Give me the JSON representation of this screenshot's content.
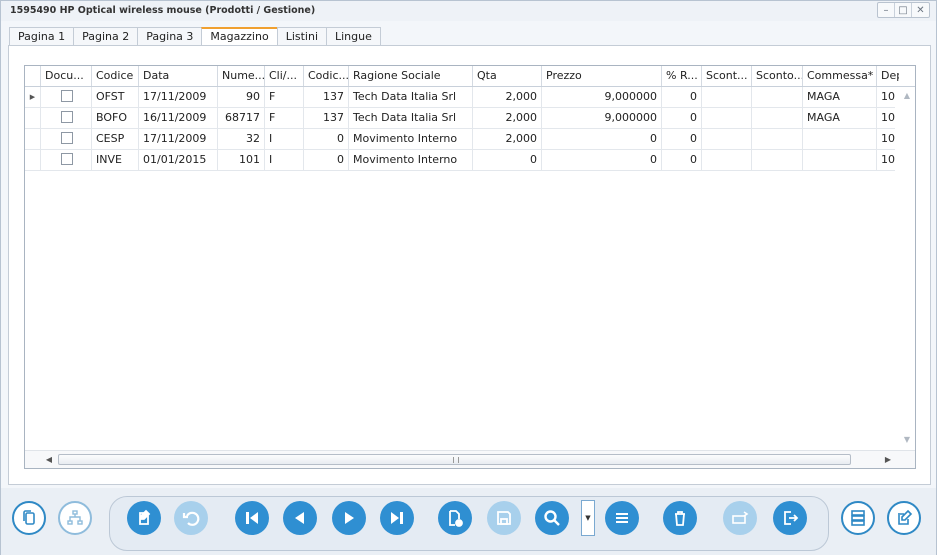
{
  "window": {
    "title": "1595490 HP Optical wireless mouse (Prodotti / Gestione)",
    "controls": [
      "minimize",
      "maximize",
      "close"
    ]
  },
  "tabs": [
    {
      "label": "Pagina 1",
      "active": false
    },
    {
      "label": "Pagina 2",
      "active": false
    },
    {
      "label": "Pagina 3",
      "active": false
    },
    {
      "label": "Magazzino",
      "active": true
    },
    {
      "label": "Listini",
      "active": false
    },
    {
      "label": "Lingue",
      "active": false
    }
  ],
  "grid": {
    "columns": [
      "Docu...",
      "Codice",
      "Data",
      "Nume...",
      "Cli/...",
      "Codic...",
      "Ragione Sociale",
      "Qta",
      "Prezzo",
      "% R...",
      "Scont...",
      "Sconto...",
      "Commessa*",
      "Dep"
    ],
    "rows": [
      {
        "documento": false,
        "codice": "OFST",
        "data": "17/11/2009",
        "numero": "90",
        "clifor": "F",
        "codice_cli": "137",
        "ragione_sociale": "Tech Data Italia Srl",
        "qta": "2,000",
        "prezzo": "9,000000",
        "perc_r": "0",
        "sconto1": "",
        "sconto2": "",
        "commessa": "MAGA",
        "dep": "10",
        "current": true
      },
      {
        "documento": false,
        "codice": "BOFO",
        "data": "16/11/2009",
        "numero": "68717",
        "clifor": "F",
        "codice_cli": "137",
        "ragione_sociale": "Tech Data Italia Srl",
        "qta": "2,000",
        "prezzo": "9,000000",
        "perc_r": "0",
        "sconto1": "",
        "sconto2": "",
        "commessa": "MAGA",
        "dep": "10",
        "current": false
      },
      {
        "documento": false,
        "codice": "CESP",
        "data": "17/11/2009",
        "numero": "32",
        "clifor": "I",
        "codice_cli": "0",
        "ragione_sociale": "Movimento Interno",
        "qta": "2,000",
        "prezzo": "0",
        "perc_r": "0",
        "sconto1": "",
        "sconto2": "",
        "commessa": "",
        "dep": "10",
        "current": false
      },
      {
        "documento": false,
        "codice": "INVE",
        "data": "01/01/2015",
        "numero": "101",
        "clifor": "I",
        "codice_cli": "0",
        "ragione_sociale": "Movimento Interno",
        "qta": "0",
        "prezzo": "0",
        "perc_r": "0",
        "sconto1": "",
        "sconto2": "",
        "commessa": "",
        "dep": "10",
        "current": false
      }
    ]
  },
  "toolbar": {
    "accent_color": "#2f8fd2",
    "buttons": [
      {
        "icon": "copy-document-icon",
        "style": "outline"
      },
      {
        "icon": "hierarchy-icon",
        "style": "outline-faded"
      },
      {
        "icon": "edit-document-icon",
        "style": "solid"
      },
      {
        "icon": "undo-icon",
        "style": "solid-faded"
      },
      {
        "icon": "first-record-icon",
        "style": "solid"
      },
      {
        "icon": "previous-record-icon",
        "style": "solid"
      },
      {
        "icon": "next-record-icon",
        "style": "solid"
      },
      {
        "icon": "last-record-icon",
        "style": "solid"
      },
      {
        "icon": "new-document-icon",
        "style": "solid"
      },
      {
        "icon": "save-icon",
        "style": "solid-faded"
      },
      {
        "icon": "search-icon",
        "style": "solid"
      },
      {
        "icon": "search-options-dropdown-icon",
        "style": "dropdown"
      },
      {
        "icon": "list-icon",
        "style": "solid"
      },
      {
        "icon": "delete-icon",
        "style": "solid"
      },
      {
        "icon": "print-icon",
        "style": "solid-faded"
      },
      {
        "icon": "exit-icon",
        "style": "solid"
      },
      {
        "icon": "database-icon",
        "style": "outline"
      },
      {
        "icon": "edit-outline-icon",
        "style": "outline"
      }
    ]
  }
}
